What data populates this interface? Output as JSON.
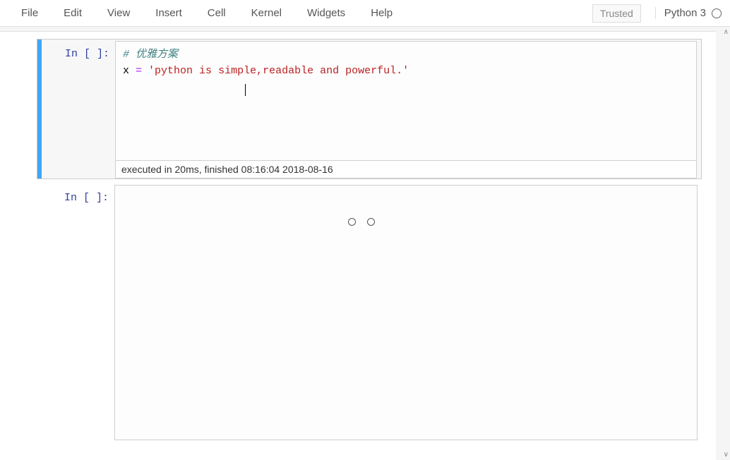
{
  "menu": {
    "file": "File",
    "edit": "Edit",
    "view": "View",
    "insert": "Insert",
    "cell": "Cell",
    "kernel": "Kernel",
    "widgets": "Widgets",
    "help": "Help"
  },
  "trusted_label": "Trusted",
  "kernel_name": "Python 3",
  "cells": {
    "cell1": {
      "prompt": "In [ ]:",
      "code": {
        "comment": "# 优雅方案",
        "line2_pre": "x ",
        "line2_op": "=",
        "line2_post": " ",
        "line2_str": "'python is simple,readable and powerful.'"
      },
      "exec_status": "executed in 20ms, finished 08:16:04 2018-08-16"
    },
    "cell2": {
      "prompt": "In [ ]:"
    }
  }
}
